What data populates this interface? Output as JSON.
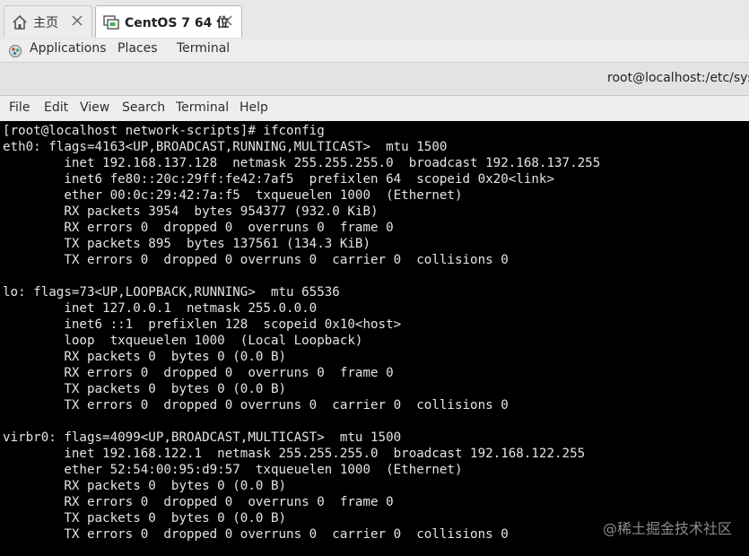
{
  "host_tabs": [
    {
      "label": "主页",
      "icon": "home-icon"
    },
    {
      "label": "CentOS 7 64 位",
      "icon": "vm-icon"
    }
  ],
  "topbar": {
    "applications": "Applications",
    "places": "Places",
    "terminal": "Terminal"
  },
  "window": {
    "title": "root@localhost:/etc/sys"
  },
  "menu": [
    "File",
    "Edit",
    "View",
    "Search",
    "Terminal",
    "Help"
  ],
  "terminal": {
    "lines": [
      "[root@localhost network-scripts]# ifconfig",
      "eth0: flags=4163<UP,BROADCAST,RUNNING,MULTICAST>  mtu 1500",
      "        inet 192.168.137.128  netmask 255.255.255.0  broadcast 192.168.137.255",
      "        inet6 fe80::20c:29ff:fe42:7af5  prefixlen 64  scopeid 0x20<link>",
      "        ether 00:0c:29:42:7a:f5  txqueuelen 1000  (Ethernet)",
      "        RX packets 3954  bytes 954377 (932.0 KiB)",
      "        RX errors 0  dropped 0  overruns 0  frame 0",
      "        TX packets 895  bytes 137561 (134.3 KiB)",
      "        TX errors 0  dropped 0 overruns 0  carrier 0  collisions 0",
      "",
      "lo: flags=73<UP,LOOPBACK,RUNNING>  mtu 65536",
      "        inet 127.0.0.1  netmask 255.0.0.0",
      "        inet6 ::1  prefixlen 128  scopeid 0x10<host>",
      "        loop  txqueuelen 1000  (Local Loopback)",
      "        RX packets 0  bytes 0 (0.0 B)",
      "        RX errors 0  dropped 0  overruns 0  frame 0",
      "        TX packets 0  bytes 0 (0.0 B)",
      "        TX errors 0  dropped 0 overruns 0  carrier 0  collisions 0",
      "",
      "virbr0: flags=4099<UP,BROADCAST,MULTICAST>  mtu 1500",
      "        inet 192.168.122.1  netmask 255.255.255.0  broadcast 192.168.122.255",
      "        ether 52:54:00:95:d9:57  txqueuelen 1000  (Ethernet)",
      "        RX packets 0  bytes 0 (0.0 B)",
      "        RX errors 0  dropped 0  overruns 0  frame 0",
      "        TX packets 0  bytes 0 (0.0 B)",
      "        TX errors 0  dropped 0 overruns 0  carrier 0  collisions 0"
    ]
  },
  "watermark": "@稀土掘金技术社区",
  "colors": {
    "terminal_bg": "#000000",
    "terminal_fg": "#e4e4e4",
    "chrome_bg": "#ededed"
  }
}
